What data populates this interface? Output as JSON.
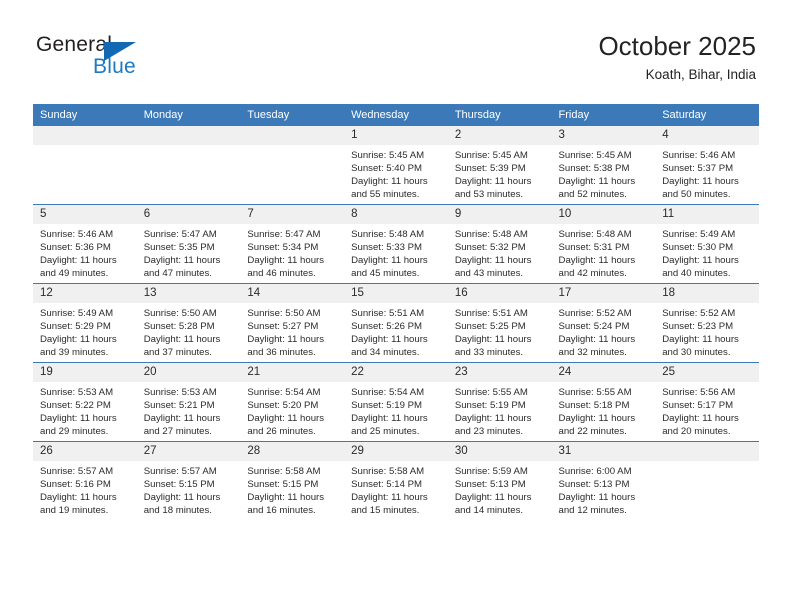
{
  "logo": {
    "word_top": "General",
    "word_bottom": "Blue",
    "triangle_color": "#1268b3",
    "blue_color": "#1c7ac2"
  },
  "header": {
    "title": "October 2025",
    "subtitle": "Koath, Bihar, India"
  },
  "theme": {
    "header_bar_color": "#3b79b8",
    "daynum_band_color": "#f0f0f0",
    "text_color": "#2b2b2b"
  },
  "weekday_headers": [
    "Sunday",
    "Monday",
    "Tuesday",
    "Wednesday",
    "Thursday",
    "Friday",
    "Saturday"
  ],
  "labels": {
    "sunrise_prefix": "Sunrise:",
    "sunset_prefix": "Sunset:",
    "daylight_prefix": "Daylight:"
  },
  "weeks": [
    [
      {
        "day": "",
        "blank": true
      },
      {
        "day": "",
        "blank": true
      },
      {
        "day": "",
        "blank": true
      },
      {
        "day": "1",
        "sunrise": "Sunrise: 5:45 AM",
        "sunset": "Sunset: 5:40 PM",
        "daylight1": "Daylight: 11 hours",
        "daylight2": "and 55 minutes."
      },
      {
        "day": "2",
        "sunrise": "Sunrise: 5:45 AM",
        "sunset": "Sunset: 5:39 PM",
        "daylight1": "Daylight: 11 hours",
        "daylight2": "and 53 minutes."
      },
      {
        "day": "3",
        "sunrise": "Sunrise: 5:45 AM",
        "sunset": "Sunset: 5:38 PM",
        "daylight1": "Daylight: 11 hours",
        "daylight2": "and 52 minutes."
      },
      {
        "day": "4",
        "sunrise": "Sunrise: 5:46 AM",
        "sunset": "Sunset: 5:37 PM",
        "daylight1": "Daylight: 11 hours",
        "daylight2": "and 50 minutes."
      }
    ],
    [
      {
        "day": "5",
        "sunrise": "Sunrise: 5:46 AM",
        "sunset": "Sunset: 5:36 PM",
        "daylight1": "Daylight: 11 hours",
        "daylight2": "and 49 minutes."
      },
      {
        "day": "6",
        "sunrise": "Sunrise: 5:47 AM",
        "sunset": "Sunset: 5:35 PM",
        "daylight1": "Daylight: 11 hours",
        "daylight2": "and 47 minutes."
      },
      {
        "day": "7",
        "sunrise": "Sunrise: 5:47 AM",
        "sunset": "Sunset: 5:34 PM",
        "daylight1": "Daylight: 11 hours",
        "daylight2": "and 46 minutes."
      },
      {
        "day": "8",
        "sunrise": "Sunrise: 5:48 AM",
        "sunset": "Sunset: 5:33 PM",
        "daylight1": "Daylight: 11 hours",
        "daylight2": "and 45 minutes."
      },
      {
        "day": "9",
        "sunrise": "Sunrise: 5:48 AM",
        "sunset": "Sunset: 5:32 PM",
        "daylight1": "Daylight: 11 hours",
        "daylight2": "and 43 minutes."
      },
      {
        "day": "10",
        "sunrise": "Sunrise: 5:48 AM",
        "sunset": "Sunset: 5:31 PM",
        "daylight1": "Daylight: 11 hours",
        "daylight2": "and 42 minutes."
      },
      {
        "day": "11",
        "sunrise": "Sunrise: 5:49 AM",
        "sunset": "Sunset: 5:30 PM",
        "daylight1": "Daylight: 11 hours",
        "daylight2": "and 40 minutes."
      }
    ],
    [
      {
        "day": "12",
        "sunrise": "Sunrise: 5:49 AM",
        "sunset": "Sunset: 5:29 PM",
        "daylight1": "Daylight: 11 hours",
        "daylight2": "and 39 minutes."
      },
      {
        "day": "13",
        "sunrise": "Sunrise: 5:50 AM",
        "sunset": "Sunset: 5:28 PM",
        "daylight1": "Daylight: 11 hours",
        "daylight2": "and 37 minutes."
      },
      {
        "day": "14",
        "sunrise": "Sunrise: 5:50 AM",
        "sunset": "Sunset: 5:27 PM",
        "daylight1": "Daylight: 11 hours",
        "daylight2": "and 36 minutes."
      },
      {
        "day": "15",
        "sunrise": "Sunrise: 5:51 AM",
        "sunset": "Sunset: 5:26 PM",
        "daylight1": "Daylight: 11 hours",
        "daylight2": "and 34 minutes."
      },
      {
        "day": "16",
        "sunrise": "Sunrise: 5:51 AM",
        "sunset": "Sunset: 5:25 PM",
        "daylight1": "Daylight: 11 hours",
        "daylight2": "and 33 minutes."
      },
      {
        "day": "17",
        "sunrise": "Sunrise: 5:52 AM",
        "sunset": "Sunset: 5:24 PM",
        "daylight1": "Daylight: 11 hours",
        "daylight2": "and 32 minutes."
      },
      {
        "day": "18",
        "sunrise": "Sunrise: 5:52 AM",
        "sunset": "Sunset: 5:23 PM",
        "daylight1": "Daylight: 11 hours",
        "daylight2": "and 30 minutes."
      }
    ],
    [
      {
        "day": "19",
        "sunrise": "Sunrise: 5:53 AM",
        "sunset": "Sunset: 5:22 PM",
        "daylight1": "Daylight: 11 hours",
        "daylight2": "and 29 minutes."
      },
      {
        "day": "20",
        "sunrise": "Sunrise: 5:53 AM",
        "sunset": "Sunset: 5:21 PM",
        "daylight1": "Daylight: 11 hours",
        "daylight2": "and 27 minutes."
      },
      {
        "day": "21",
        "sunrise": "Sunrise: 5:54 AM",
        "sunset": "Sunset: 5:20 PM",
        "daylight1": "Daylight: 11 hours",
        "daylight2": "and 26 minutes."
      },
      {
        "day": "22",
        "sunrise": "Sunrise: 5:54 AM",
        "sunset": "Sunset: 5:19 PM",
        "daylight1": "Daylight: 11 hours",
        "daylight2": "and 25 minutes."
      },
      {
        "day": "23",
        "sunrise": "Sunrise: 5:55 AM",
        "sunset": "Sunset: 5:19 PM",
        "daylight1": "Daylight: 11 hours",
        "daylight2": "and 23 minutes."
      },
      {
        "day": "24",
        "sunrise": "Sunrise: 5:55 AM",
        "sunset": "Sunset: 5:18 PM",
        "daylight1": "Daylight: 11 hours",
        "daylight2": "and 22 minutes."
      },
      {
        "day": "25",
        "sunrise": "Sunrise: 5:56 AM",
        "sunset": "Sunset: 5:17 PM",
        "daylight1": "Daylight: 11 hours",
        "daylight2": "and 20 minutes."
      }
    ],
    [
      {
        "day": "26",
        "sunrise": "Sunrise: 5:57 AM",
        "sunset": "Sunset: 5:16 PM",
        "daylight1": "Daylight: 11 hours",
        "daylight2": "and 19 minutes."
      },
      {
        "day": "27",
        "sunrise": "Sunrise: 5:57 AM",
        "sunset": "Sunset: 5:15 PM",
        "daylight1": "Daylight: 11 hours",
        "daylight2": "and 18 minutes."
      },
      {
        "day": "28",
        "sunrise": "Sunrise: 5:58 AM",
        "sunset": "Sunset: 5:15 PM",
        "daylight1": "Daylight: 11 hours",
        "daylight2": "and 16 minutes."
      },
      {
        "day": "29",
        "sunrise": "Sunrise: 5:58 AM",
        "sunset": "Sunset: 5:14 PM",
        "daylight1": "Daylight: 11 hours",
        "daylight2": "and 15 minutes."
      },
      {
        "day": "30",
        "sunrise": "Sunrise: 5:59 AM",
        "sunset": "Sunset: 5:13 PM",
        "daylight1": "Daylight: 11 hours",
        "daylight2": "and 14 minutes."
      },
      {
        "day": "31",
        "sunrise": "Sunrise: 6:00 AM",
        "sunset": "Sunset: 5:13 PM",
        "daylight1": "Daylight: 11 hours",
        "daylight2": "and 12 minutes."
      },
      {
        "day": "",
        "blank": true
      }
    ]
  ]
}
